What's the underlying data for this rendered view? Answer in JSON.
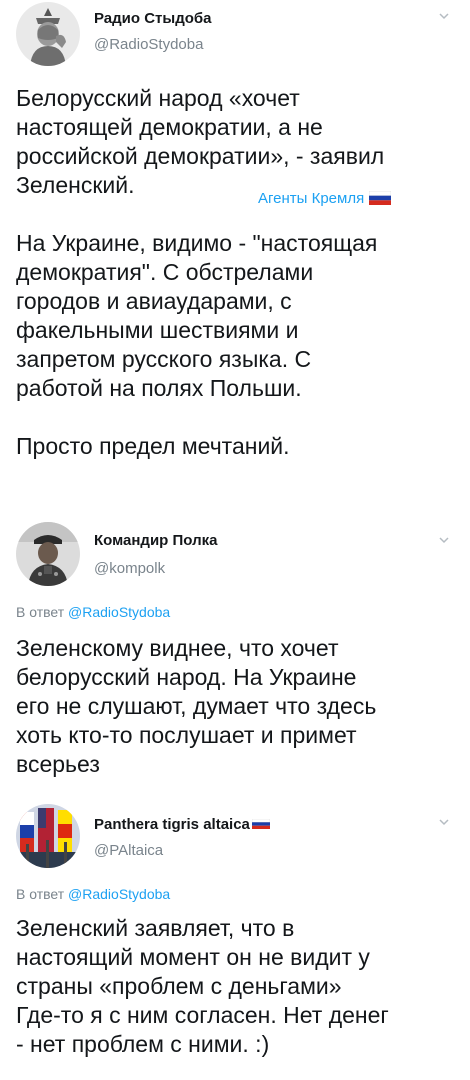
{
  "tweets": [
    {
      "name": "Радио Стыдоба",
      "handle": "@RadioStydoba",
      "body_lines": [
        "Белорусский народ «хочет",
        "настоящей демократии, а не",
        "российской демократии», - заявил",
        "Зеленский.",
        "",
        "На Украине, видимо - \"настоящая",
        "демократия\". С обстрелами",
        "городов и авиаударами, с",
        "факельными шествиями и",
        "запретом русского языка. С",
        "работой на полях Польши.",
        "",
        "Просто предел мечтаний."
      ],
      "source_label": "Агенты Кремля"
    },
    {
      "name": "Командир Полка",
      "handle": "@kompolk",
      "reply_prefix": "В ответ",
      "reply_handle": "@RadioStydoba",
      "body_lines": [
        "Зеленскому виднее, что хочет",
        "белорусский народ. На Украине",
        "его не слушают, думает что здесь",
        "хоть кто-то послушает и примет",
        "всерьез"
      ]
    },
    {
      "name": "Panthera tigris altaica",
      "handle": "@PAltaica",
      "reply_prefix": "В ответ",
      "reply_handle": "@RadioStydoba",
      "body_lines": [
        "Зеленский заявляет, что в",
        "настоящий момент он не видит у",
        "страны «проблем с деньгами»",
        "Где-то я с ним согласен. Нет денег",
        "- нет проблем с ними. :)"
      ]
    }
  ],
  "icons": {
    "chevron": "chevron-down-icon",
    "flag": "russian-flag-icon"
  },
  "colors": {
    "text": "#14171a",
    "secondary": "#7a848c",
    "link": "#1da1f2"
  }
}
